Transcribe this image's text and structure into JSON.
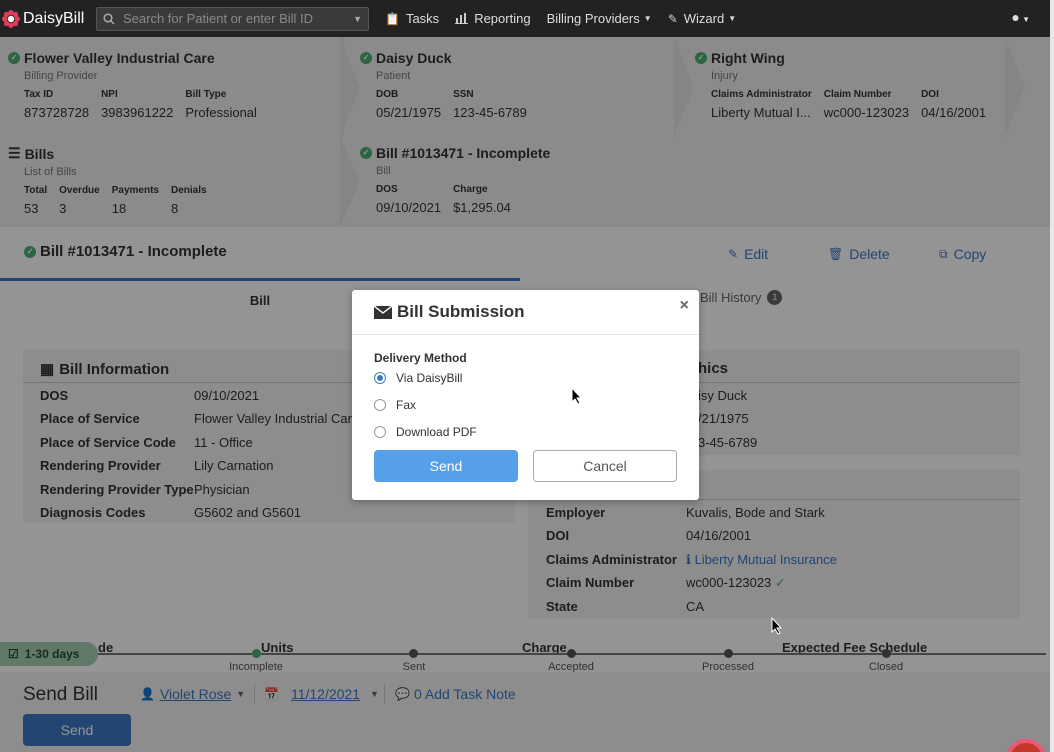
{
  "nav": {
    "logo_text": "DaisyBill",
    "search_placeholder": "Search for Patient or enter Bill ID",
    "tasks": "Tasks",
    "reporting": "Reporting",
    "billing_providers": "Billing Providers",
    "wizard": "Wizard"
  },
  "cards": {
    "provider": {
      "title": "Flower Valley Industrial Care",
      "subtitle": "Billing Provider",
      "fields": [
        {
          "k": "Tax ID",
          "v": "873728728"
        },
        {
          "k": "NPI",
          "v": "3983961222"
        },
        {
          "k": "Bill Type",
          "v": "Professional"
        }
      ]
    },
    "patient": {
      "title": "Daisy Duck",
      "subtitle": "Patient",
      "fields": [
        {
          "k": "DOB",
          "v": "05/21/1975"
        },
        {
          "k": "SSN",
          "v": "123-45-6789"
        }
      ]
    },
    "injury": {
      "title": "Right Wing",
      "subtitle": "Injury",
      "fields": [
        {
          "k": "Claims Administrator",
          "v": "Liberty Mutual I..."
        },
        {
          "k": "Claim Number",
          "v": "wc000-123023"
        },
        {
          "k": "DOI",
          "v": "04/16/2001"
        }
      ]
    },
    "bills": {
      "title": "Bills",
      "subtitle": "List of Bills",
      "fields": [
        {
          "k": "Total",
          "v": "53"
        },
        {
          "k": "Overdue",
          "v": "3"
        },
        {
          "k": "Payments",
          "v": "18"
        },
        {
          "k": "Denials",
          "v": "8"
        }
      ]
    },
    "bill": {
      "title": "Bill #1013471 - Incomplete",
      "subtitle": "Bill",
      "fields": [
        {
          "k": "DOS",
          "v": "09/10/2021"
        },
        {
          "k": "Charge",
          "v": "$1,295.04"
        }
      ]
    }
  },
  "bill_header": {
    "title": "Bill #1013471 - Incomplete",
    "edit": "Edit",
    "delete": "Delete",
    "copy": "Copy"
  },
  "tabs": {
    "bill": "Bill",
    "history": "Bill History",
    "history_count": "1"
  },
  "bill_info": {
    "title": "Bill Information",
    "rows": [
      {
        "label": "DOS",
        "value": "09/10/2021"
      },
      {
        "label": "Place of Service",
        "value": "Flower Valley Industrial Care"
      },
      {
        "label": "Place of Service Code",
        "value": "11 - Office"
      },
      {
        "label": "Rendering Provider",
        "value": "Lily Carnation"
      },
      {
        "label": "Rendering Provider Type",
        "value": "Physician"
      },
      {
        "label": "Diagnosis Codes",
        "value": "G5602 and G5601"
      }
    ]
  },
  "demographics": {
    "title_fragment": "hics",
    "values": [
      "isy Duck",
      "/21/1975",
      "3-45-6789"
    ]
  },
  "injury_info": {
    "rows": [
      {
        "label": "Employer",
        "value": "Kuvalis, Bode and Stark"
      },
      {
        "label": "DOI",
        "value": "04/16/2001"
      },
      {
        "label": "Claims Administrator",
        "value": "Liberty Mutual Insurance"
      },
      {
        "label": "Claim Number",
        "value": "wc000-123023"
      },
      {
        "label": "State",
        "value": "CA"
      }
    ]
  },
  "line_items_header": {
    "code_fragment": "de",
    "units": "Units",
    "charge": "Charge",
    "expected": "Expected Fee Schedule"
  },
  "timeline": {
    "days_badge": "1-30 days",
    "steps": [
      "Incomplete",
      "Sent",
      "Accepted",
      "Processed",
      "Closed"
    ]
  },
  "send_bill": {
    "title": "Send Bill",
    "assignee": "Violet Rose",
    "date": "11/12/2021",
    "task_note": "0 Add Task Note",
    "send_button": "Send"
  },
  "modal": {
    "title": "Bill Submission",
    "close": "×",
    "delivery_label": "Delivery Method",
    "options": [
      {
        "label": "Via DaisyBill",
        "selected": true
      },
      {
        "label": "Fax",
        "selected": false
      },
      {
        "label": "Download PDF",
        "selected": false
      }
    ],
    "send": "Send",
    "cancel": "Cancel"
  }
}
